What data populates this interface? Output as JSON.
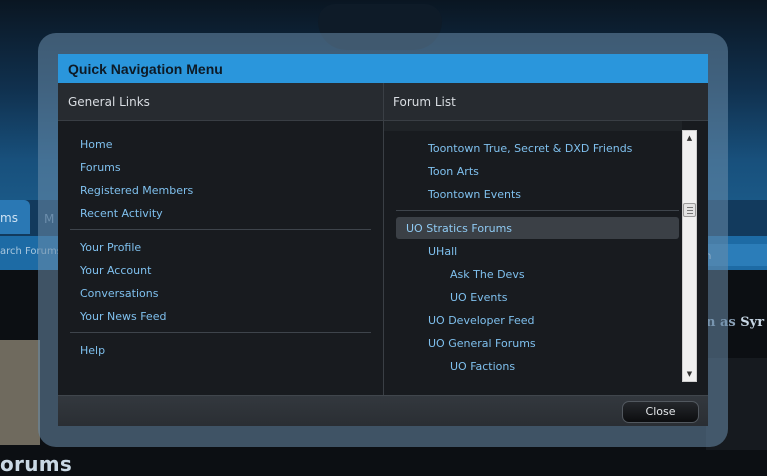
{
  "background": {
    "active_tab": "ms",
    "second_tab": "M",
    "search_left": "arch Forums",
    "search_right": "h",
    "signin_prefix": "n as ",
    "signin_name": "Syr",
    "page_title": "orums"
  },
  "modal": {
    "title": "Quick Navigation Menu",
    "general_links": {
      "heading": "General Links",
      "groups": [
        [
          "Home",
          "Forums",
          "Registered Members",
          "Recent Activity"
        ],
        [
          "Your Profile",
          "Your Account",
          "Conversations",
          "Your News Feed"
        ],
        [
          "Help"
        ]
      ]
    },
    "forum_list": {
      "heading": "Forum List",
      "items_before": [
        "Toontown True, Secret & DXD Friends",
        "Toon Arts",
        "Toontown Events"
      ],
      "category": "UO Stratics Forums",
      "items_after": [
        {
          "label": "UHall",
          "level": 1
        },
        {
          "label": "Ask The Devs",
          "level": 2
        },
        {
          "label": "UO Events",
          "level": 2
        },
        {
          "label": "UO Developer Feed",
          "level": 1
        },
        {
          "label": "UO General Forums",
          "level": 1
        },
        {
          "label": "UO Factions",
          "level": 2
        }
      ]
    },
    "close_label": "Close"
  },
  "colors": {
    "title_bar": "#2a96dc",
    "link": "#7fc0ee",
    "panel": "#181b1f"
  }
}
